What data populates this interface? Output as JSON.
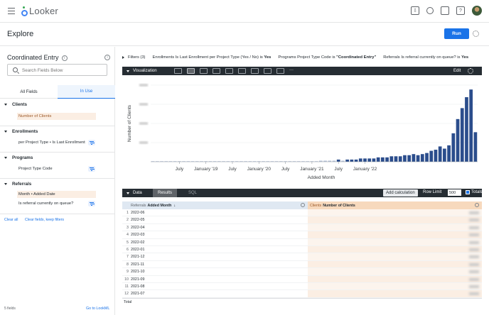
{
  "app": {
    "name": "Looker"
  },
  "page": {
    "title": "Explore",
    "run_label": "Run"
  },
  "explore": {
    "title": "Coordinated Entry",
    "search_placeholder": "Search Fields Below",
    "tabs": [
      "All Fields",
      "In Use"
    ],
    "active_tab": "In Use",
    "sections": [
      {
        "name": "Clients",
        "fields": [
          {
            "label": "Number of Clients",
            "selected": true,
            "filter": false
          }
        ]
      },
      {
        "name": "Enrollments",
        "fields": [
          {
            "label": "per Project Type • Is Last Enrollment",
            "selected": false,
            "filter": true
          }
        ]
      },
      {
        "name": "Programs",
        "fields": [
          {
            "label": "Project Type Code",
            "selected": false,
            "filter": true
          }
        ]
      },
      {
        "name": "Referrals",
        "fields": [
          {
            "label": "Month • Added Date",
            "selected": true,
            "filter": false
          },
          {
            "label": "Is referral currently on queue?",
            "selected": false,
            "filter": true
          }
        ]
      }
    ],
    "clear_all": "Clear all",
    "clear_fields": "Clear fields, keep filters",
    "fields_count": "5 fields",
    "go_to_lookml": "Go to LookML"
  },
  "filters": {
    "label": "Filters (3)",
    "items": [
      {
        "prefix": "Enrollments Is Last Enrollment per Project Type (Yes / No) is ",
        "value": "Yes"
      },
      {
        "prefix": "Programs Project Type Code is ",
        "value": "\"Coordinated Entry\""
      },
      {
        "prefix": "Referrals Is referral currently on queue? is ",
        "value": "Yes"
      }
    ]
  },
  "visualization": {
    "label": "Visualization",
    "edit": "Edit"
  },
  "chart_data": {
    "type": "bar",
    "xlabel": "Added Month",
    "ylabel": "Number of Clients",
    "x_tick_labels": [
      "July",
      "January '19",
      "July",
      "January '20",
      "July",
      "January '21",
      "July",
      "January '22"
    ],
    "values": [
      0.5,
      0.5,
      0.5,
      0.5,
      0.5,
      0.5,
      0.5,
      0.5,
      0.5,
      0.5,
      0.5,
      0.5,
      0.5,
      0.5,
      0.5,
      0.5,
      0.5,
      0.5,
      0.5,
      0.5,
      0.5,
      0.5,
      0.5,
      0.5,
      0.5,
      0.5,
      0.5,
      0.5,
      0.5,
      0.5,
      0.5,
      0.5,
      0.5,
      0.5,
      0.5,
      0.5,
      0.5,
      0.5,
      1,
      1,
      1,
      1,
      2,
      1,
      2,
      2,
      2,
      3,
      3,
      3,
      3,
      4,
      4,
      4,
      5,
      5,
      5,
      6,
      6,
      7,
      6,
      7,
      8,
      10,
      11,
      14,
      12,
      15,
      26,
      39,
      49,
      59,
      66,
      27
    ],
    "ylim": [
      0,
      70
    ],
    "grid": true,
    "color": "#2b4d8c",
    "y_ticks_visible": false
  },
  "data_panel": {
    "label": "Data",
    "tabs": [
      "Results",
      "SQL"
    ],
    "add_calculation": "Add calculation",
    "row_limit_label": "Row Limit",
    "row_limit": "500",
    "totals_label": "Totals",
    "columns": [
      {
        "group": "Referrals",
        "name": "Added Month"
      },
      {
        "group": "Clients",
        "name": "Number of Clients"
      }
    ],
    "rows": [
      {
        "n": "1",
        "month": "2022-06"
      },
      {
        "n": "2",
        "month": "2022-05"
      },
      {
        "n": "3",
        "month": "2022-04"
      },
      {
        "n": "4",
        "month": "2022-03"
      },
      {
        "n": "5",
        "month": "2022-02"
      },
      {
        "n": "6",
        "month": "2022-01"
      },
      {
        "n": "7",
        "month": "2021-12"
      },
      {
        "n": "8",
        "month": "2021-11"
      },
      {
        "n": "9",
        "month": "2021-10"
      },
      {
        "n": "10",
        "month": "2021-09"
      },
      {
        "n": "11",
        "month": "2021-08"
      },
      {
        "n": "12",
        "month": "2021-07"
      }
    ],
    "total_label": "Total"
  }
}
